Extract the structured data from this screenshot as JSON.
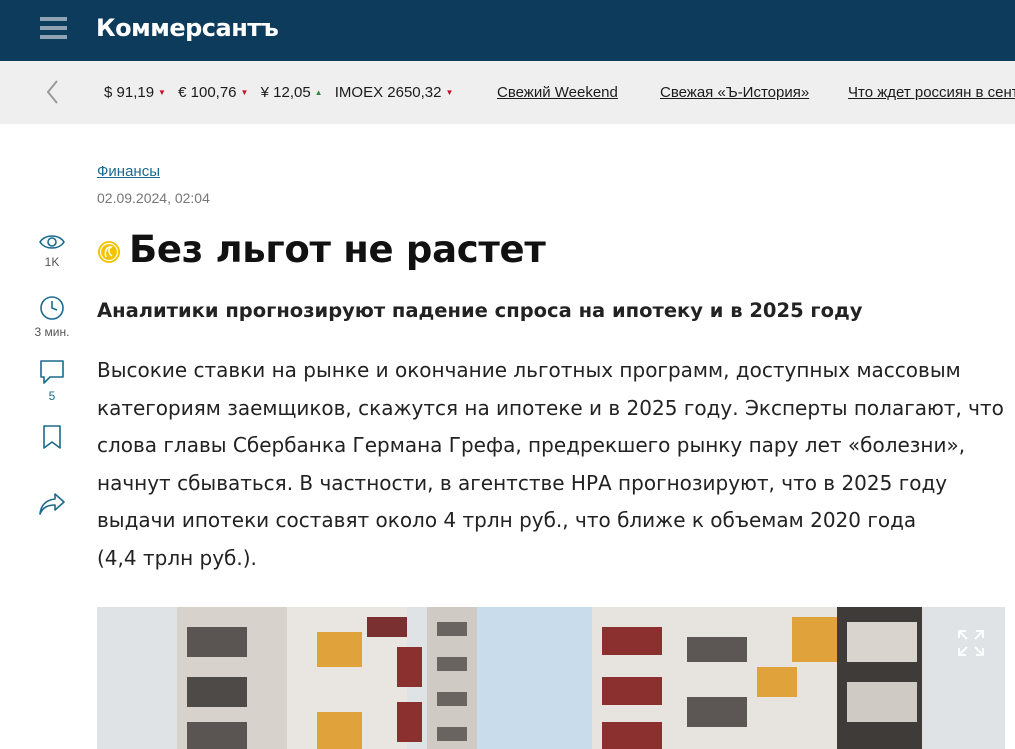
{
  "header": {
    "logo": "Коммерсантъ"
  },
  "ticker": {
    "quotes": [
      {
        "label": "$ 91,19",
        "trend": "down"
      },
      {
        "label": "€ 100,76",
        "trend": "down"
      },
      {
        "label": "¥ 12,05",
        "trend": "up"
      },
      {
        "label": "IMOEX 2650,32",
        "trend": "down"
      }
    ],
    "links": [
      "Свежий Weekend",
      "Свежая «Ъ-История»",
      "Что ждет россиян в сентябре"
    ]
  },
  "article": {
    "rubric": "Финансы",
    "date": "02.09.2024, 02:04",
    "title": "Без льгот не растет",
    "subtitle": "Аналитики прогнозируют падение спроса на ипотеку и в 2025 году",
    "lead_lines": [
      "Высокие ставки на рынке и окончание льготных программ, доступных массовым",
      "категориям заемщиков, скажутся на ипотеке и в 2025 году. Эксперты полагают, что",
      "слова главы Сбербанка Германа Грефа, предрекшего рынку пару лет «болезни»,",
      "начнут сбываться. В частности, в агентстве НРА прогнозируют, что в 2025 году",
      "выдачи ипотеки составят около 4 трлн руб., что ближе к объемам 2020 года",
      "(4,4 трлн руб.)."
    ]
  },
  "rail": {
    "views": "1K",
    "read_time": "3 мин.",
    "comments": "5"
  },
  "colors": {
    "header_bg": "#0d3b5c",
    "ticker_bg": "#efefef",
    "link": "#1b6a8e",
    "down": "#c8102e",
    "up": "#2e8b3d",
    "badge": "#f2c300"
  },
  "icons": [
    "menu-icon",
    "chevron-left-icon",
    "eye-icon",
    "clock-icon",
    "comment-icon",
    "bookmark-icon",
    "share-icon",
    "premium-badge-icon",
    "expand-icon"
  ]
}
